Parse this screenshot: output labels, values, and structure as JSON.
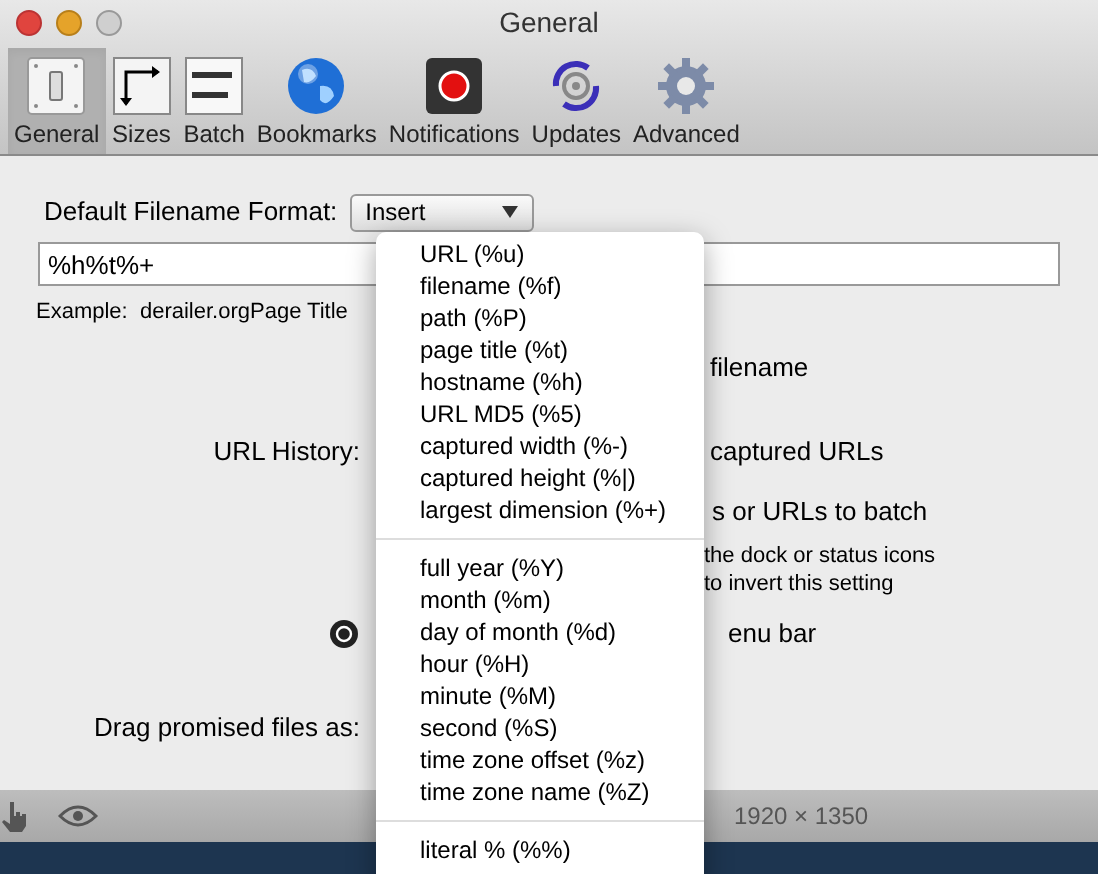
{
  "window": {
    "title": "General"
  },
  "toolbar": [
    {
      "label": "General",
      "kind": "switch",
      "selected": true
    },
    {
      "label": "Sizes",
      "kind": "sizes",
      "selected": false
    },
    {
      "label": "Batch",
      "kind": "batch",
      "selected": false
    },
    {
      "label": "Bookmarks",
      "kind": "globe",
      "selected": false
    },
    {
      "label": "Notifications",
      "kind": "record",
      "selected": false
    },
    {
      "label": "Updates",
      "kind": "updates",
      "selected": false
    },
    {
      "label": "Advanced",
      "kind": "gear",
      "selected": false
    }
  ],
  "filename_format": {
    "label": "Default Filename Format:",
    "popup": "Insert",
    "value": "%h%t%+",
    "example": "Example:  derailer.orgPage Title"
  },
  "filename_option": {
    "text": "filename"
  },
  "url_history": {
    "label": "URL History:",
    "suffix": "captured URLs"
  },
  "batch_option": {
    "text": "s or URLs to batch",
    "hint_1": "the dock or status icons",
    "hint_2": "to invert this setting"
  },
  "menubar_option": {
    "text": "enu bar"
  },
  "drag": {
    "label": "Drag promised files as:"
  },
  "status_bar": {
    "dimensions": "1920 × 1350"
  },
  "insert_menu": [
    [
      {
        "label": "URL (%u)"
      },
      {
        "label": "filename (%f)"
      },
      {
        "label": "path (%P)"
      },
      {
        "label": "page title (%t)"
      },
      {
        "label": "hostname (%h)"
      },
      {
        "label": "URL MD5 (%5)"
      },
      {
        "label": "captured width (%-)"
      },
      {
        "label": "captured height (%|)"
      },
      {
        "label": "largest dimension (%+)"
      }
    ],
    [
      {
        "label": "full year (%Y)"
      },
      {
        "label": "month (%m)"
      },
      {
        "label": "day of month (%d)"
      },
      {
        "label": "hour (%H)"
      },
      {
        "label": "minute (%M)"
      },
      {
        "label": "second (%S)"
      },
      {
        "label": "time zone offset (%z)"
      },
      {
        "label": "time zone name (%Z)"
      }
    ],
    [
      {
        "label": "literal % (%%)"
      }
    ]
  ]
}
